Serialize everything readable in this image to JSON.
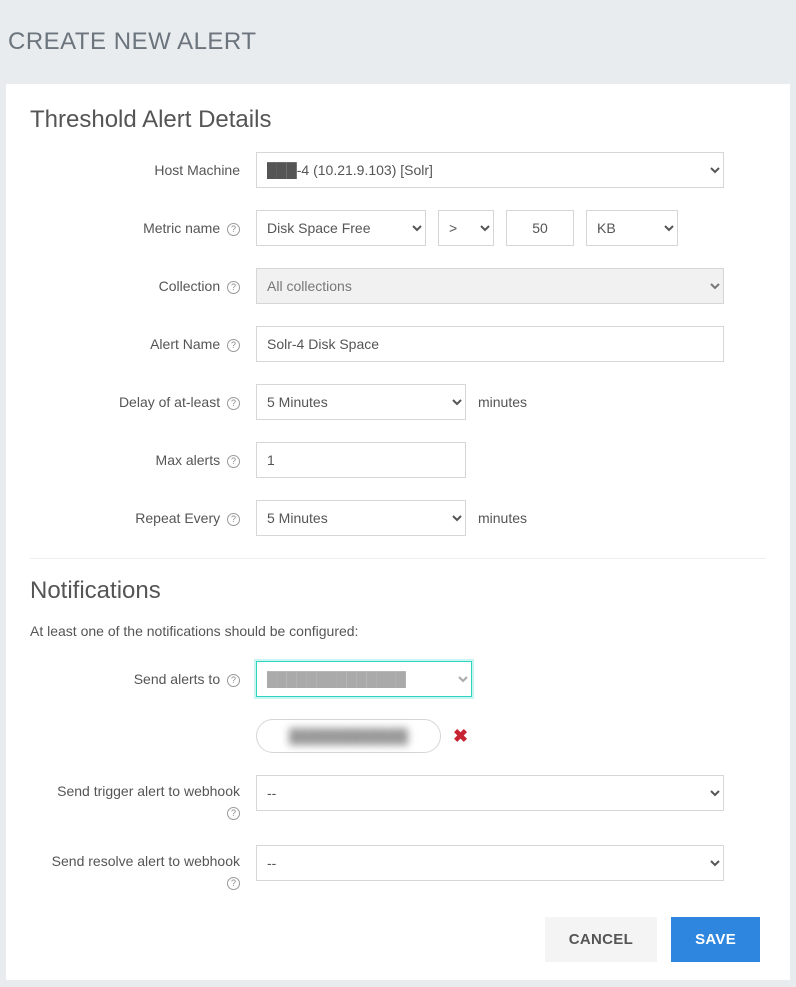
{
  "page": {
    "title": "CREATE NEW ALERT"
  },
  "details": {
    "section_title": "Threshold Alert Details",
    "host_label": "Host Machine",
    "host_prefix": "████",
    "host_suffix": "-4 (10.21.9.103) [Solr]",
    "metric_label": "Metric name",
    "metric_value": "Disk Space Free",
    "operator": ">",
    "threshold": "50",
    "unit": "KB",
    "collection_label": "Collection",
    "collection_value": "All collections",
    "alert_name_label": "Alert Name",
    "alert_name_value": "Solr-4 Disk Space",
    "delay_label": "Delay of at-least",
    "delay_value": "5 Minutes",
    "delay_suffix": "minutes",
    "max_alerts_label": "Max alerts",
    "max_alerts_value": "1",
    "repeat_label": "Repeat Every",
    "repeat_value": "5 Minutes",
    "repeat_suffix": "minutes"
  },
  "notifications": {
    "section_title": "Notifications",
    "subtitle": "At least one of the notifications should be configured:",
    "send_to_label": "Send alerts to",
    "send_to_value": "(redacted recipient)",
    "chip_value": "(redacted@email)",
    "trigger_label": "Send trigger alert to webhook",
    "trigger_value": "--",
    "resolve_label": "Send resolve alert to webhook",
    "resolve_value": "--"
  },
  "actions": {
    "cancel": "CANCEL",
    "save": "SAVE"
  }
}
